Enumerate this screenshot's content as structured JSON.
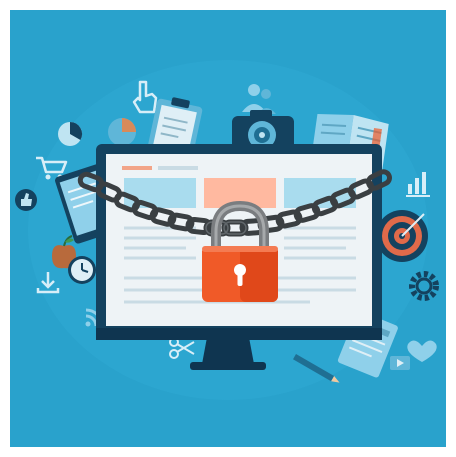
{
  "illustration": {
    "subject": "locked-computer-monitor",
    "colors": {
      "background": "#29a2cc",
      "background_deep": "#1f87ad",
      "icon_light": "#8fd0ea",
      "icon_mid": "#5fb6d8",
      "monitor_frame": "#14425f",
      "screen": "#eef3f6",
      "chain": "#3a3f42",
      "lock_body": "#f05a28",
      "lock_shackle": "#7a7d80"
    },
    "icons": [
      "cursor-hand-icon",
      "clipboard-icon",
      "users-icon",
      "camera-icon",
      "open-book-icon",
      "pie-chart-icon",
      "shopping-cart-icon",
      "thumbs-up-icon",
      "bar-chart-icon",
      "target-icon",
      "apple-icon",
      "clock-icon",
      "download-icon",
      "gear-icon",
      "wifi-icon",
      "heart-icon",
      "pencil-icon",
      "video-icon",
      "document-icon"
    ]
  }
}
